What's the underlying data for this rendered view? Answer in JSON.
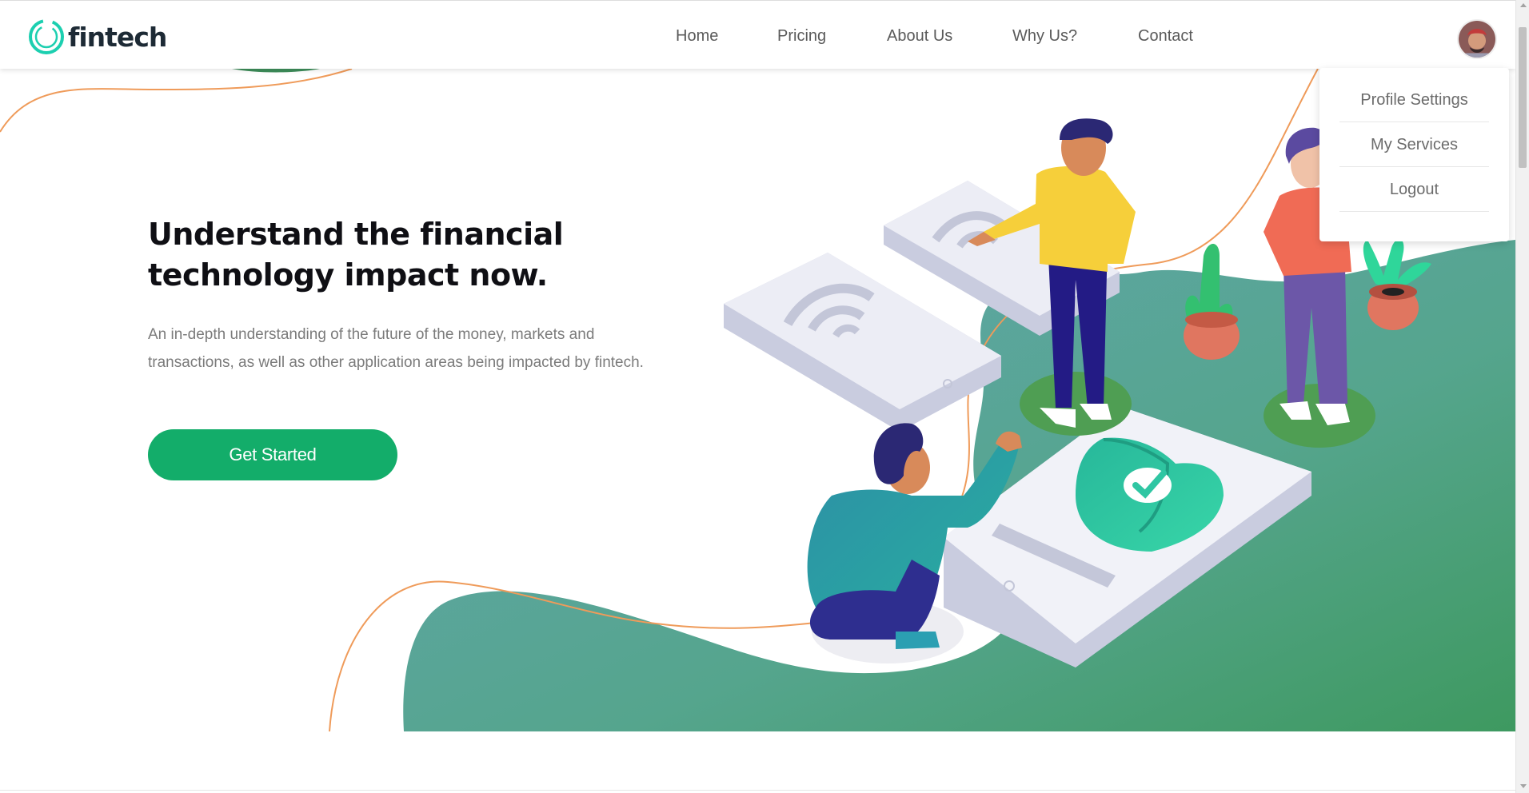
{
  "brand": {
    "name": "fintech",
    "accent": "#13ad6a",
    "logo_ring_color": "#1ccfb0"
  },
  "nav": {
    "items": [
      {
        "label": "Home"
      },
      {
        "label": "Pricing"
      },
      {
        "label": "About Us"
      },
      {
        "label": "Why Us?"
      },
      {
        "label": "Contact"
      }
    ]
  },
  "user_menu": {
    "avatar_icon": "user-avatar",
    "items": [
      {
        "label": "Profile Settings"
      },
      {
        "label": "My Services"
      },
      {
        "label": "Logout"
      }
    ]
  },
  "hero": {
    "title": "Understand the financial technology impact now.",
    "description": "An in-depth understanding of the future of the money, markets and transactions, as well as other application areas being impacted by fintech.",
    "cta_label": "Get Started",
    "illustration_icon": "fintech-people-illustration",
    "colors": {
      "teal": "#5fa4ad",
      "green": "#3e9e63",
      "wave_line": "#ef9b5a",
      "shield": "#2fc6a3"
    }
  }
}
